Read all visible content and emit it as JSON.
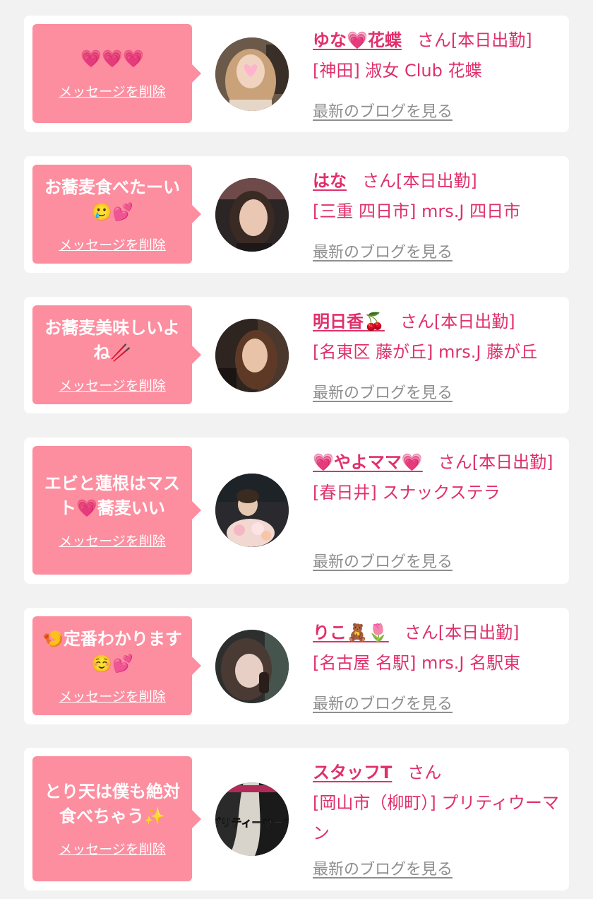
{
  "delete_label": "メッセージを削除",
  "blog_label": "最新のブログを見る",
  "accent_color": "#fc8ea0",
  "name_color": "#e0306b",
  "items": [
    {
      "message": "💗💗💗",
      "name": "ゆな💗花蝶",
      "honorific": "さん",
      "status": "[本日出勤]",
      "location": "[神田] 淑女 Club 花蝶"
    },
    {
      "message": "お蕎麦食べたーい🥲💕",
      "name": "はな",
      "honorific": "さん",
      "status": "[本日出勤]",
      "location": "[三重 四日市] mrs.J 四日市"
    },
    {
      "message": "お蕎麦美味しいよね🥢",
      "name": "明日香🍒",
      "honorific": "さん",
      "status": "[本日出勤]",
      "location": "[名東区 藤が丘] mrs.J 藤が丘"
    },
    {
      "message": "エビと蓮根はマスト💗蕎麦いい",
      "name": "💗やよママ💗",
      "honorific": "さん",
      "status": "[本日出勤]",
      "location": "[春日井] スナックステラ"
    },
    {
      "message": "🍤定番わかります☺️💕",
      "name": "りこ🧸🌷",
      "honorific": "さん",
      "status": "[本日出勤]",
      "location": "[名古屋 名駅] mrs.J 名駅東"
    },
    {
      "message": "とり天は僕も絶対食べちゃう✨",
      "name": "スタッフT",
      "honorific": "さん",
      "status": "",
      "location": "[岡山市（柳町）] プリティウーマン",
      "avatar_text": "プリティーウーマ"
    }
  ]
}
